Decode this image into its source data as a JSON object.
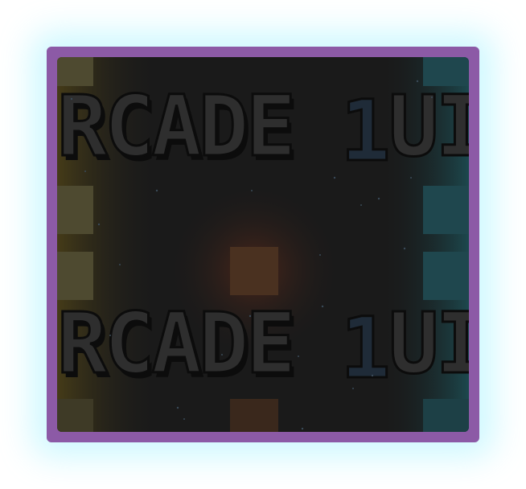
{
  "game": {
    "logo_text": "RCADE",
    "logo_badge": "1",
    "logo_suffix": "UI",
    "colors": {
      "frame": "#8c5aa6",
      "glow": "#bff5ff",
      "screen_bg": "#1a1a1a",
      "logo_fill": "#2e2e2e",
      "logo_outline": "#0c0c0c",
      "badge_fill": "#1f2b38",
      "left_stripe": "#5a5436",
      "right_stripe": "#1f4a52",
      "center_block": "#4a3120"
    }
  }
}
